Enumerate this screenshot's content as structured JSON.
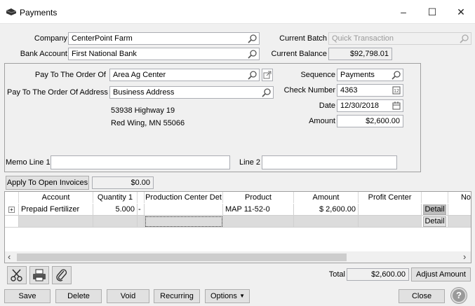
{
  "window": {
    "title": "Payments",
    "minimize": "–",
    "maximize": "☐",
    "close": "✕"
  },
  "header": {
    "company_label": "Company",
    "company_value": "CenterPoint Farm",
    "bank_label": "Bank Account",
    "bank_value": "First National Bank",
    "batch_label": "Current Batch",
    "batch_value": "Quick Transaction",
    "balance_label": "Current Balance",
    "balance_value": "$92,798.01"
  },
  "payee": {
    "order_label": "Pay To The Order Of",
    "order_value": "Area Ag Center",
    "address_label": "Pay To The Order Of Address",
    "address_value": "Business Address",
    "address_line1": "53938 Highway 19",
    "address_line2": "Red Wing, MN  55066",
    "sequence_label": "Sequence",
    "sequence_value": "Payments",
    "check_label": "Check Number",
    "check_value": "4363",
    "date_label": "Date",
    "date_value": "12/30/2018",
    "amount_label": "Amount",
    "amount_value": "$2,600.00",
    "memo1_label": "Memo Line 1",
    "memo1_value": "",
    "memo2_label": "Line 2",
    "memo2_value": ""
  },
  "apply": {
    "button_label": "Apply To Open Invoices",
    "value": "$0.00"
  },
  "grid": {
    "columns": [
      "Account",
      "Quantity 1",
      "Production Center Det",
      "Product",
      "Amount",
      "Profit Center",
      "No"
    ],
    "rows": [
      {
        "expander": "+",
        "account": "Prepaid Fertilizer",
        "quantity": "5.000",
        "dropdown": "-",
        "production_center": "",
        "product": "MAP 11-52-0",
        "amount": "$ 2,600.00",
        "profit_center": "",
        "detail": "Detail"
      },
      {
        "expander": "",
        "account": "",
        "quantity": "",
        "dropdown": "",
        "production_center": "",
        "product": "",
        "amount": "",
        "profit_center": "",
        "detail": "Detail"
      }
    ],
    "scroll_left": "‹",
    "scroll_right": "›"
  },
  "footer": {
    "total_label": "Total",
    "total_value": "$2,600.00",
    "adjust_label": "Adjust Amount",
    "save": "Save",
    "delete": "Delete",
    "void": "Void",
    "recurring": "Recurring",
    "options": "Options",
    "options_arrow": "▼",
    "close": "Close",
    "help": "?"
  }
}
